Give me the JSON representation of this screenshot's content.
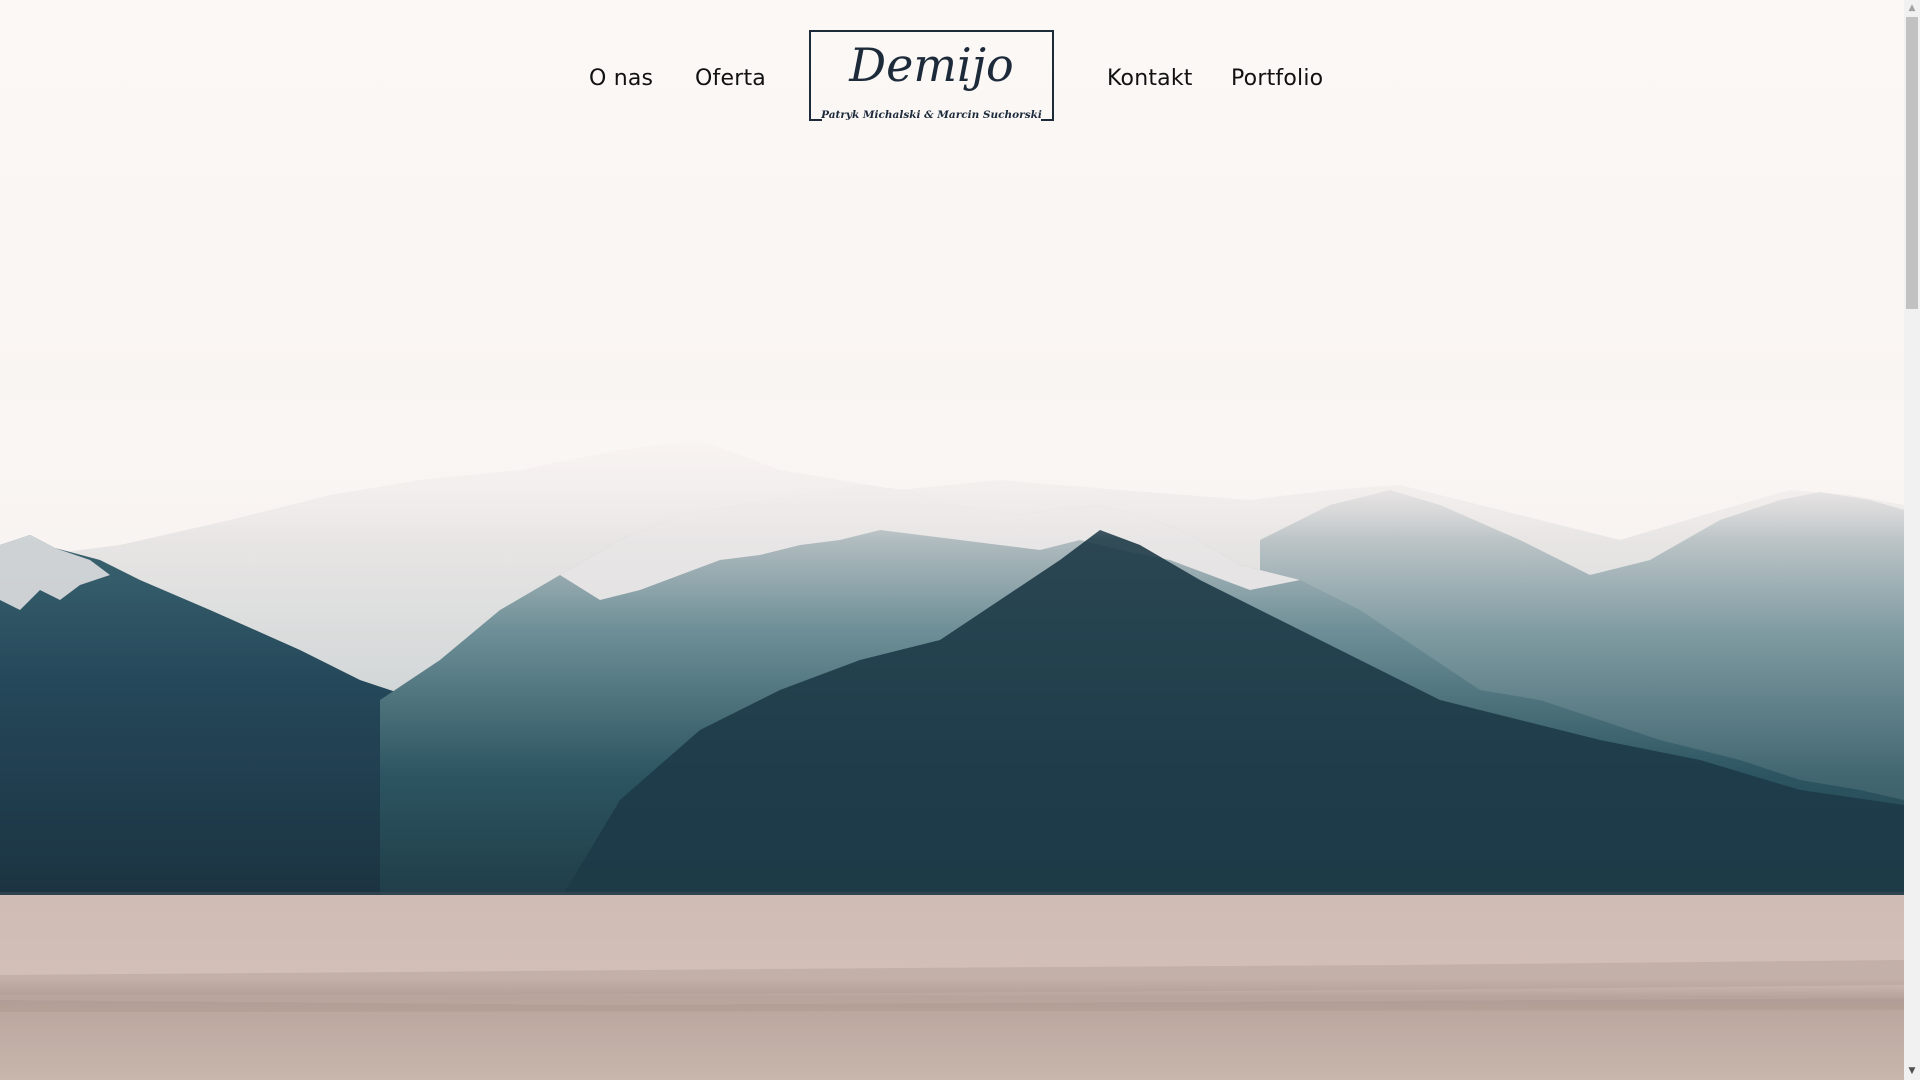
{
  "nav": {
    "left": [
      {
        "label": "O nas"
      },
      {
        "label": "Oferta"
      }
    ],
    "right": [
      {
        "label": "Kontakt"
      },
      {
        "label": "Portfolio"
      }
    ]
  },
  "logo": {
    "title": "Demijo",
    "subtitle": "Patryk Michalski & Marcin Suchorski"
  },
  "colors": {
    "background": "#faf7f5",
    "text": "#111111",
    "logo": "#1c2a3a",
    "mountain_dark": "#1e3a45",
    "water": "#cdb8ae"
  },
  "scrollbar": {
    "up_icon": "chevron-up-icon",
    "down_icon": "chevron-down-icon",
    "position": 0
  }
}
